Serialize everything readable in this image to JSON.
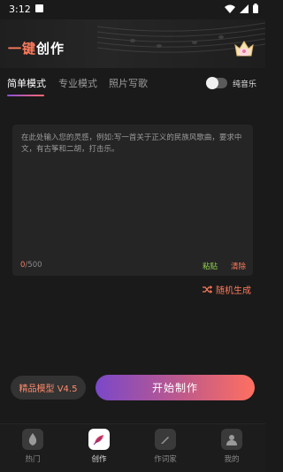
{
  "status_bar": {
    "time": "3:12"
  },
  "header": {
    "title_part1": "一键",
    "title_part2": "创作"
  },
  "tabs": [
    {
      "label": "简单模式",
      "active": true
    },
    {
      "label": "专业模式",
      "active": false
    },
    {
      "label": "照片写歌",
      "active": false
    }
  ],
  "pure_music": {
    "label": "纯音乐",
    "on": false
  },
  "input": {
    "placeholder": "在此处输入您的灵感，例如:写一首关于正义的民族风歌曲，要求中文，有古筝和二胡，打击乐。",
    "count_current": "0",
    "count_max": "/500",
    "paste_label": "粘贴",
    "clear_label": "清除"
  },
  "random_generate": {
    "label": "随机生成"
  },
  "actions": {
    "model_label": "精品模型 V4.5",
    "start_label": "开始制作"
  },
  "bottom_nav": [
    {
      "label": "热门",
      "icon": "flame-icon",
      "active": false
    },
    {
      "label": "创作",
      "icon": "feather-icon",
      "active": true
    },
    {
      "label": "作词家",
      "icon": "pen-icon",
      "active": false
    },
    {
      "label": "我的",
      "icon": "user-icon",
      "active": false
    }
  ],
  "colors": {
    "accent": "#ff7a5c",
    "paste": "#8fd14f",
    "gradient_start": "#7a48c9",
    "gradient_end": "#ff7060"
  }
}
